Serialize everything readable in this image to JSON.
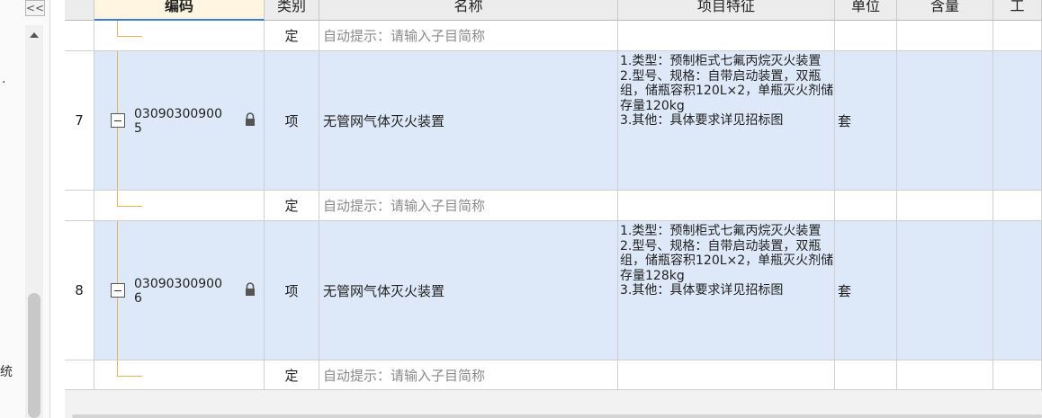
{
  "sidebar": {
    "collapse_label": "<<",
    "label_1": "·",
    "label_2": "统"
  },
  "headers": {
    "code": "编码",
    "type": "类别",
    "name": "名称",
    "feature": "项目特征",
    "unit": "单位",
    "qty": "含量",
    "extra": "工"
  },
  "rows": {
    "sub_a": {
      "type": "定",
      "name_hint": "自动提示：请输入子目简称"
    },
    "item7": {
      "index": "7",
      "code": "03090300900\n5",
      "type": "项",
      "name": "无管网气体灭火装置",
      "feature": "1.类型：预制柜式七氟丙烷灭火装置\n2.型号、规格：自带启动装置，双瓶组，储瓶容积120L×2，单瓶灭火剂储存量120kg\n3.其他：具体要求详见招标图",
      "unit": "套"
    },
    "sub_b": {
      "type": "定",
      "name_hint": "自动提示：请输入子目简称"
    },
    "item8": {
      "index": "8",
      "code": "03090300900\n6",
      "type": "项",
      "name": "无管网气体灭火装置",
      "feature": "1.类型：预制柜式七氟丙烷灭火装置\n2.型号、规格：自带启动装置，双瓶组，储瓶容积120L×2，单瓶灭火剂储存量128kg\n3.其他：具体要求详见招标图",
      "unit": "套"
    },
    "sub_c": {
      "type": "定",
      "name_hint": "自动提示：请输入子目简称"
    }
  },
  "colors": {
    "selected_row": "#dde8f8",
    "tree_line": "#e8b35a",
    "active_header": "#fff5e1"
  }
}
